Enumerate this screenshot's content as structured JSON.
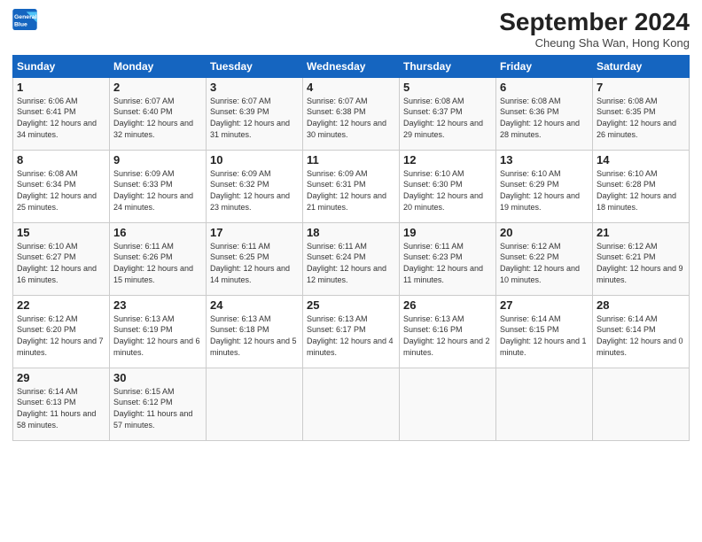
{
  "header": {
    "logo_line1": "General",
    "logo_line2": "Blue",
    "month": "September 2024",
    "location": "Cheung Sha Wan, Hong Kong"
  },
  "weekdays": [
    "Sunday",
    "Monday",
    "Tuesday",
    "Wednesday",
    "Thursday",
    "Friday",
    "Saturday"
  ],
  "weeks": [
    [
      {
        "day": "1",
        "sunrise": "6:06 AM",
        "sunset": "6:41 PM",
        "daylight": "12 hours and 34 minutes."
      },
      {
        "day": "2",
        "sunrise": "6:07 AM",
        "sunset": "6:40 PM",
        "daylight": "12 hours and 32 minutes."
      },
      {
        "day": "3",
        "sunrise": "6:07 AM",
        "sunset": "6:39 PM",
        "daylight": "12 hours and 31 minutes."
      },
      {
        "day": "4",
        "sunrise": "6:07 AM",
        "sunset": "6:38 PM",
        "daylight": "12 hours and 30 minutes."
      },
      {
        "day": "5",
        "sunrise": "6:08 AM",
        "sunset": "6:37 PM",
        "daylight": "12 hours and 29 minutes."
      },
      {
        "day": "6",
        "sunrise": "6:08 AM",
        "sunset": "6:36 PM",
        "daylight": "12 hours and 28 minutes."
      },
      {
        "day": "7",
        "sunrise": "6:08 AM",
        "sunset": "6:35 PM",
        "daylight": "12 hours and 26 minutes."
      }
    ],
    [
      {
        "day": "8",
        "sunrise": "6:08 AM",
        "sunset": "6:34 PM",
        "daylight": "12 hours and 25 minutes."
      },
      {
        "day": "9",
        "sunrise": "6:09 AM",
        "sunset": "6:33 PM",
        "daylight": "12 hours and 24 minutes."
      },
      {
        "day": "10",
        "sunrise": "6:09 AM",
        "sunset": "6:32 PM",
        "daylight": "12 hours and 23 minutes."
      },
      {
        "day": "11",
        "sunrise": "6:09 AM",
        "sunset": "6:31 PM",
        "daylight": "12 hours and 21 minutes."
      },
      {
        "day": "12",
        "sunrise": "6:10 AM",
        "sunset": "6:30 PM",
        "daylight": "12 hours and 20 minutes."
      },
      {
        "day": "13",
        "sunrise": "6:10 AM",
        "sunset": "6:29 PM",
        "daylight": "12 hours and 19 minutes."
      },
      {
        "day": "14",
        "sunrise": "6:10 AM",
        "sunset": "6:28 PM",
        "daylight": "12 hours and 18 minutes."
      }
    ],
    [
      {
        "day": "15",
        "sunrise": "6:10 AM",
        "sunset": "6:27 PM",
        "daylight": "12 hours and 16 minutes."
      },
      {
        "day": "16",
        "sunrise": "6:11 AM",
        "sunset": "6:26 PM",
        "daylight": "12 hours and 15 minutes."
      },
      {
        "day": "17",
        "sunrise": "6:11 AM",
        "sunset": "6:25 PM",
        "daylight": "12 hours and 14 minutes."
      },
      {
        "day": "18",
        "sunrise": "6:11 AM",
        "sunset": "6:24 PM",
        "daylight": "12 hours and 12 minutes."
      },
      {
        "day": "19",
        "sunrise": "6:11 AM",
        "sunset": "6:23 PM",
        "daylight": "12 hours and 11 minutes."
      },
      {
        "day": "20",
        "sunrise": "6:12 AM",
        "sunset": "6:22 PM",
        "daylight": "12 hours and 10 minutes."
      },
      {
        "day": "21",
        "sunrise": "6:12 AM",
        "sunset": "6:21 PM",
        "daylight": "12 hours and 9 minutes."
      }
    ],
    [
      {
        "day": "22",
        "sunrise": "6:12 AM",
        "sunset": "6:20 PM",
        "daylight": "12 hours and 7 minutes."
      },
      {
        "day": "23",
        "sunrise": "6:13 AM",
        "sunset": "6:19 PM",
        "daylight": "12 hours and 6 minutes."
      },
      {
        "day": "24",
        "sunrise": "6:13 AM",
        "sunset": "6:18 PM",
        "daylight": "12 hours and 5 minutes."
      },
      {
        "day": "25",
        "sunrise": "6:13 AM",
        "sunset": "6:17 PM",
        "daylight": "12 hours and 4 minutes."
      },
      {
        "day": "26",
        "sunrise": "6:13 AM",
        "sunset": "6:16 PM",
        "daylight": "12 hours and 2 minutes."
      },
      {
        "day": "27",
        "sunrise": "6:14 AM",
        "sunset": "6:15 PM",
        "daylight": "12 hours and 1 minute."
      },
      {
        "day": "28",
        "sunrise": "6:14 AM",
        "sunset": "6:14 PM",
        "daylight": "12 hours and 0 minutes."
      }
    ],
    [
      {
        "day": "29",
        "sunrise": "6:14 AM",
        "sunset": "6:13 PM",
        "daylight": "11 hours and 58 minutes."
      },
      {
        "day": "30",
        "sunrise": "6:15 AM",
        "sunset": "6:12 PM",
        "daylight": "11 hours and 57 minutes."
      },
      null,
      null,
      null,
      null,
      null
    ]
  ]
}
